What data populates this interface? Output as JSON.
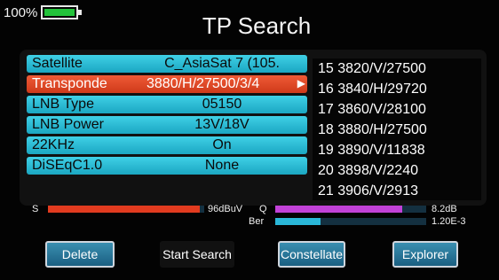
{
  "status": {
    "battery_label": "100%",
    "battery_color": "#22c23a"
  },
  "title": "TP Search",
  "menu": [
    {
      "label": "Satellite",
      "value": "C_AsiaSat 7 (105.",
      "active": false
    },
    {
      "label": "Transponde",
      "value": "3880/H/27500/3/4",
      "active": true
    },
    {
      "label": "LNB Type",
      "value": "05150",
      "active": false
    },
    {
      "label": "LNB Power",
      "value": "13V/18V",
      "active": false
    },
    {
      "label": "22KHz",
      "value": "On",
      "active": false
    },
    {
      "label": "DiSEqC1.0",
      "value": "None",
      "active": false
    }
  ],
  "transponders": [
    "15 3820/V/27500",
    "16 3840/H/29720",
    "17 3860/V/28100",
    "18 3880/H/27500",
    "19 3890/V/11838",
    "20 3898/V/2240",
    "21 3906/V/2913"
  ],
  "signal": {
    "s_label": "S",
    "s_value": "96dBuV",
    "s_level": 0.97,
    "q_label": "Q",
    "q_value": "8.2dB",
    "q_level": 0.84,
    "ber_label": "Ber",
    "ber_value": "1.20E-3",
    "ber_level": 0.3
  },
  "colors": {
    "accent_cyan": "#1ba7c2",
    "active_red": "#cf3a1a",
    "s_bar": "#e23b1f",
    "q_bar": "#c242d8",
    "ber_bar": "#2ab7d8"
  },
  "buttons": {
    "delete": "Delete",
    "start_search": "Start Search",
    "constellate": "Constellate",
    "explorer": "Explorer"
  }
}
